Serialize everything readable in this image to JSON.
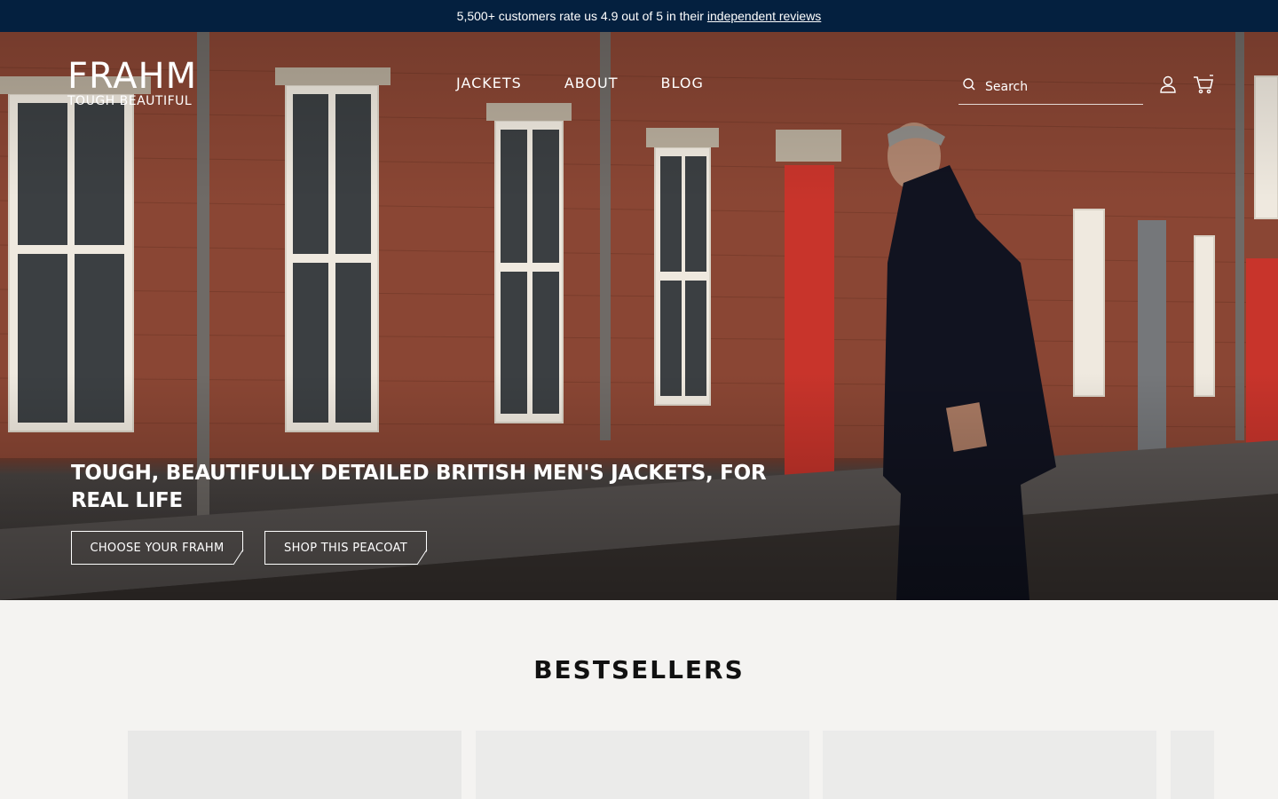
{
  "announcement": {
    "text": "5,500+ customers rate us 4.9 out of 5 in their",
    "link": "independent reviews"
  },
  "brand": {
    "name": "FRAHM",
    "tagline": "TOUGH BEAUTIFUL"
  },
  "nav": {
    "items": [
      "JACKETS",
      "ABOUT",
      "BLOG"
    ]
  },
  "search": {
    "placeholder": "Search",
    "icon": "search-icon"
  },
  "header_icons": [
    "account-icon",
    "cart-icon"
  ],
  "hero": {
    "title": "TOUGH, BEAUTIFULLY DETAILED BRITISH MEN'S JACKETS, FOR REAL LIFE",
    "cta_primary": "CHOOSE YOUR FRAHM",
    "cta_secondary": "SHOP THIS PEACOAT"
  },
  "bestsellers": {
    "title": "BESTSELLERS",
    "card_count_visible": 4
  },
  "colors": {
    "announcement_bg": "#04203f",
    "page_bg": "#f4f3f1",
    "card_bg": "#ebebea"
  }
}
